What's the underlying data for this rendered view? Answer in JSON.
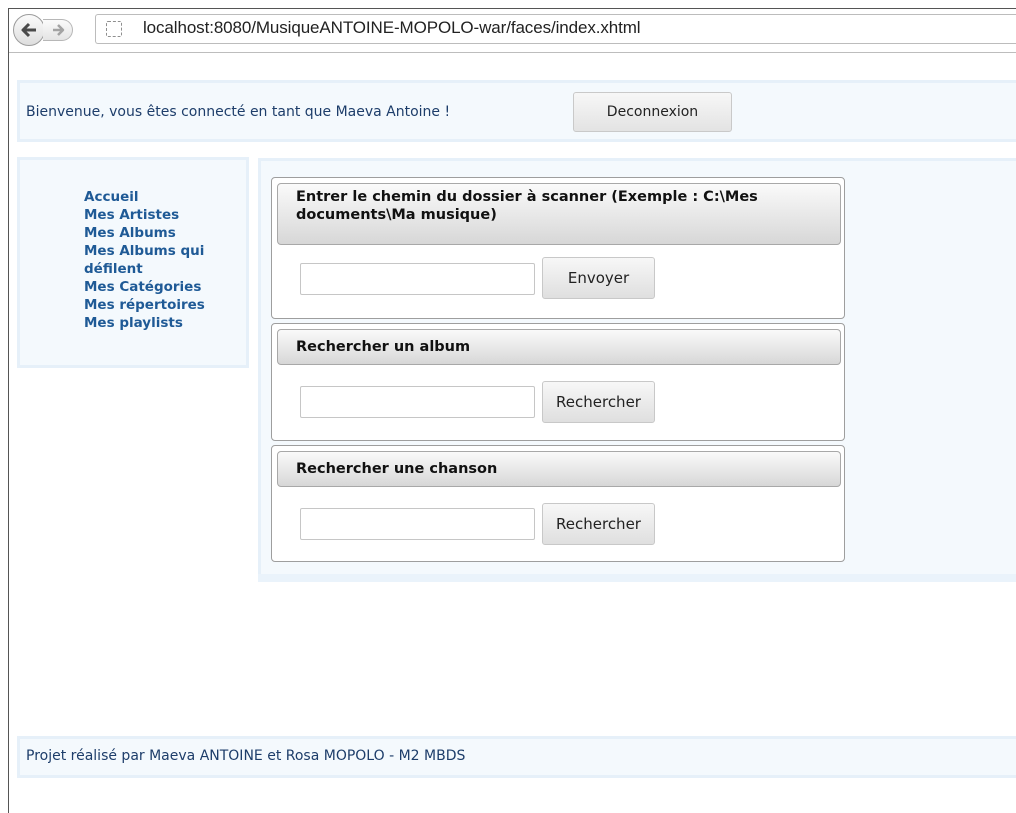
{
  "browser": {
    "url": "localhost:8080/MusiqueANTOINE-MOPOLO-war/faces/index.xhtml"
  },
  "header": {
    "welcome": "Bienvenue, vous êtes connecté en tant que Maeva Antoine !",
    "logout_label": "Deconnexion"
  },
  "menu": {
    "items": [
      {
        "label": "Accueil"
      },
      {
        "label": "Mes Artistes"
      },
      {
        "label": "Mes Albums"
      },
      {
        "label": "Mes Albums qui défilent"
      },
      {
        "label": "Mes Catégories"
      },
      {
        "label": "Mes répertoires"
      },
      {
        "label": "Mes playlists"
      }
    ]
  },
  "panels": {
    "scan": {
      "title": "Entrer le chemin du dossier à scanner (Exemple : C:\\Mes documents\\Ma musique)",
      "input_value": "",
      "button_label": "Envoyer"
    },
    "album_search": {
      "title": "Rechercher un album",
      "input_value": "",
      "button_label": "Rechercher"
    },
    "song_search": {
      "title": "Rechercher une chanson",
      "input_value": "",
      "button_label": "Rechercher"
    }
  },
  "footer": {
    "text": "Projet réalisé par Maeva ANTOINE et Rosa MOPOLO - M2 MBDS"
  },
  "colors": {
    "link": "#1f5a96",
    "panel_bg": "#f4f9fd",
    "panel_border": "#e6f0f9"
  }
}
